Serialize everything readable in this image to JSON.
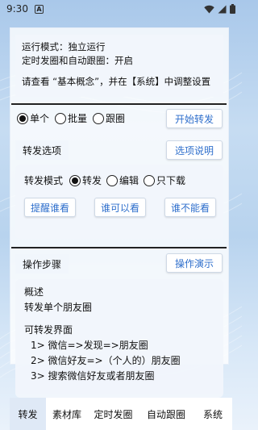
{
  "status": {
    "time": "9:30",
    "notification_letter": "A"
  },
  "mode": {
    "line1": "运行模式：独立运行",
    "line2": "定时发圈和自动跟圈：开启",
    "line3": "请查看 “基本概念”，并在【系统】中调整设置"
  },
  "forward_type": {
    "options": [
      "单个",
      "批量",
      "跟圈"
    ],
    "selected": "单个",
    "start_button": "开始转发"
  },
  "forward_options": {
    "label": "转发选项",
    "help_button": "选项说明",
    "mode_title": "转发模式",
    "modes": [
      "转发",
      "编辑",
      "只下载"
    ],
    "selected_mode": "转发",
    "buttons": [
      "提醒谁看",
      "谁可以看",
      "谁不能看"
    ]
  },
  "steps": {
    "label": "操作步骤",
    "demo_button": "操作演示",
    "lines": [
      "概述",
      "转发单个朋友圈",
      "",
      "可转发界面",
      "1> 微信=>发现=>朋友圈",
      "2> 微信好友=>（个人的）朋友圈",
      "3> 搜索微信好友或者朋友圈"
    ]
  },
  "bottom_nav": {
    "items": [
      "转发",
      "素材库",
      "定时发圈",
      "自动跟圈",
      "系统"
    ],
    "active": "转发"
  },
  "colors": {
    "accent": "#2f6fcc",
    "active_tab_bg": "#dfe9f6"
  }
}
